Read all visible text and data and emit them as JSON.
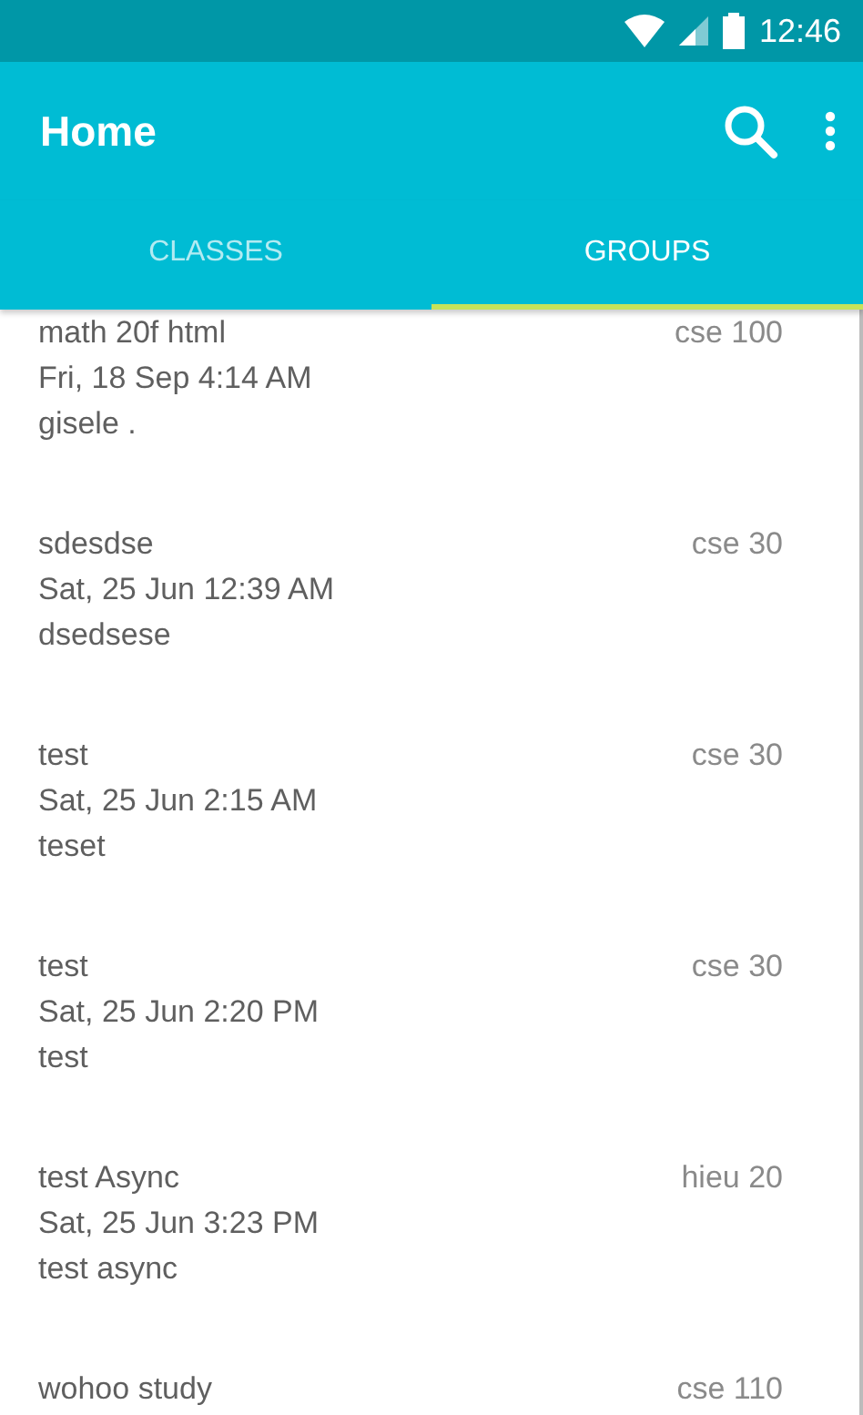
{
  "status_bar": {
    "time": "12:46"
  },
  "toolbar": {
    "title": "Home"
  },
  "tabs": [
    {
      "label": "CLASSES",
      "selected": false
    },
    {
      "label": "GROUPS",
      "selected": true
    }
  ],
  "groups": [
    {
      "title": "math 20f html",
      "date": "Fri, 18 Sep 4:14 AM",
      "subtitle": "gisele .",
      "course": "cse 100"
    },
    {
      "title": "sdesdse",
      "date": "Sat, 25 Jun 12:39 AM",
      "subtitle": "dsedsese",
      "course": "cse 30"
    },
    {
      "title": "test",
      "date": "Sat, 25 Jun 2:15 AM",
      "subtitle": "teset",
      "course": "cse 30"
    },
    {
      "title": "test",
      "date": "Sat, 25 Jun 2:20 PM",
      "subtitle": "test",
      "course": "cse 30"
    },
    {
      "title": "test Async",
      "date": "Sat, 25 Jun 3:23 PM",
      "subtitle": "test async",
      "course": "hieu 20"
    },
    {
      "title": "wohoo study",
      "course": "cse 110"
    }
  ]
}
